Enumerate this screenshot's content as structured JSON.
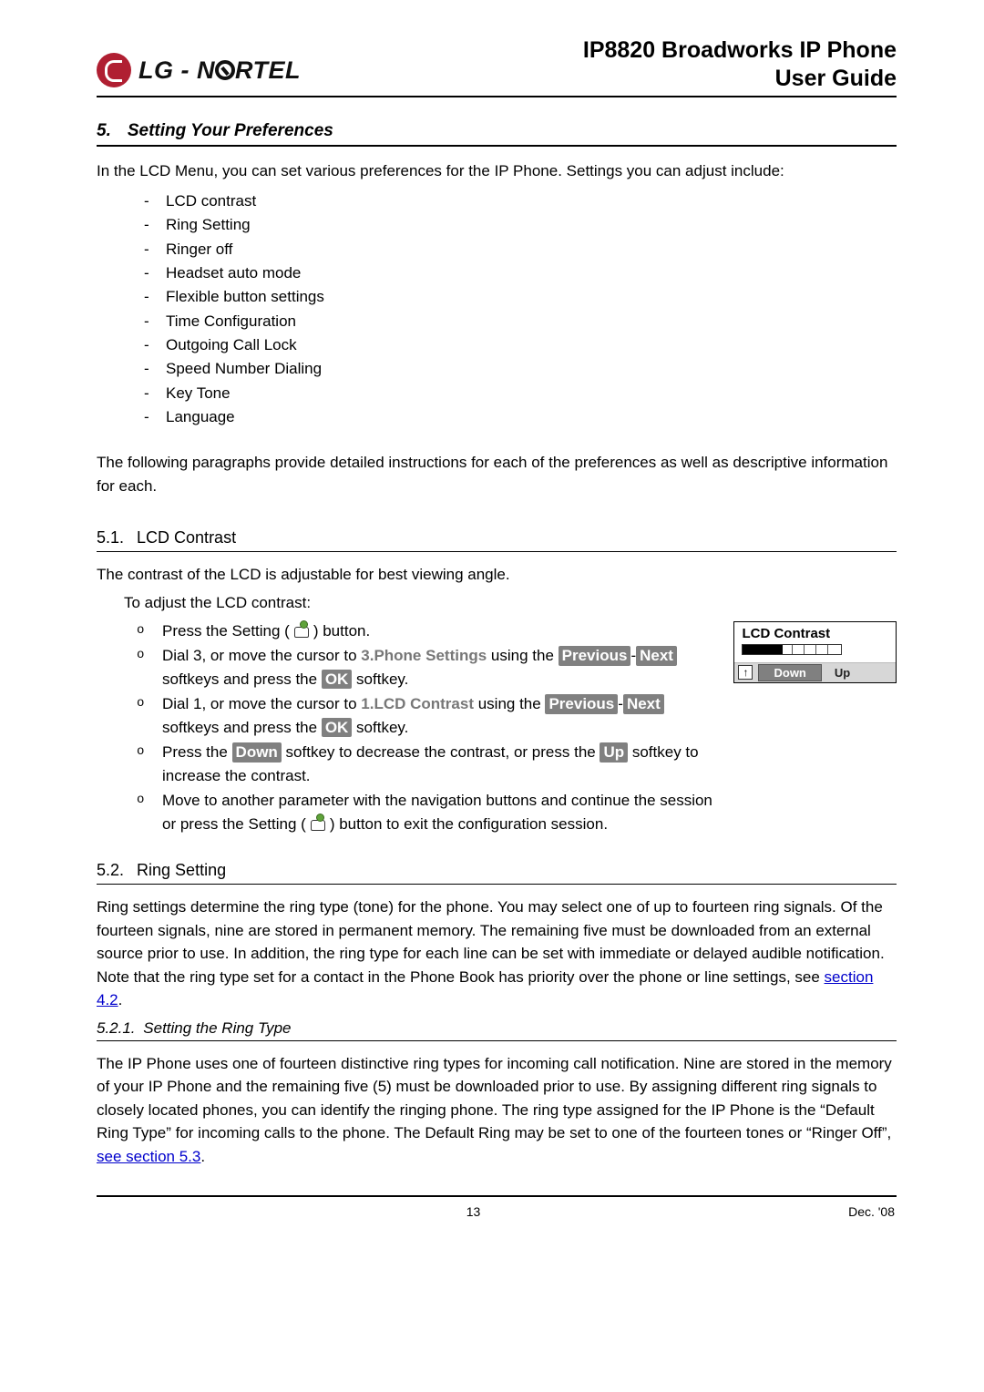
{
  "header": {
    "logo_text": "LG-N   RTEL",
    "title_l1": "IP8820 Broadworks IP Phone",
    "title_l2": "User Guide"
  },
  "section5": {
    "num": "5.",
    "title": "Setting Your Preferences",
    "intro": "In the LCD Menu, you can set various preferences for the IP Phone.  Settings you can adjust include:",
    "items": [
      "LCD contrast",
      "Ring Setting",
      "Ringer off",
      "Headset auto mode",
      "Flexible button settings",
      "Time Configuration",
      "Outgoing Call Lock",
      "Speed Number Dialing",
      "Key Tone",
      "Language"
    ],
    "outro": "The following paragraphs provide detailed instructions for each of the preferences as well as descriptive information for each."
  },
  "section51": {
    "num": "5.1.",
    "title": "LCD Contrast",
    "intro": "The contrast of the LCD is adjustable for best viewing angle.",
    "lead": "To adjust the LCD contrast:",
    "step1_a": "Press the Setting (",
    "step1_b": ") button.",
    "step2_a": "Dial 3, or move the cursor to ",
    "step2_menu": "3.Phone Settings",
    "step2_b": " using the ",
    "step2_c": " softkeys and press the ",
    "step2_d": " softkey.",
    "step3_a": "Dial 1, or move the cursor to ",
    "step3_menu": "1.LCD Contrast",
    "step3_b": " using the ",
    "step3_c": " softkeys and press the ",
    "step3_d": " softkey.",
    "step4_a": "Press the ",
    "step4_b": " softkey to decrease the contrast, or press the ",
    "step4_c": " softkey to increase the contrast.",
    "step5_a": "Move to another parameter with the navigation buttons and continue the session or press the Setting (",
    "step5_b": ") button to exit the configuration session.",
    "soft_previous": "Previous",
    "soft_next": "Next",
    "soft_ok": "OK",
    "soft_down": "Down",
    "soft_up": "Up",
    "lcd": {
      "title": "LCD Contrast",
      "down": "Down",
      "up": "Up",
      "arrow": "↑"
    }
  },
  "section52": {
    "num": "5.2.",
    "title": "Ring Setting",
    "para_a": "Ring settings determine the ring type (tone) for the phone.  You may select one of up to fourteen ring signals.  Of the fourteen signals, nine are stored in permanent memory.  The remaining five must be downloaded from an external source prior to use.  In addition, the ring type for each line can be set with immediate or delayed audible notification.  Note that the ring type set for a contact in the Phone Book has priority over the phone or line settings, see ",
    "link1": "section 4.2",
    "para_b": "."
  },
  "section521": {
    "num": "5.2.1.",
    "title": "Setting the Ring Type",
    "para_a": "The IP Phone uses one of fourteen distinctive ring types for incoming call notification.  Nine are stored in the memory of your IP Phone and the remaining five (5) must be downloaded prior to use.  By assigning different ring signals to closely located phones, you can identify the ringing phone.  The ring type assigned for the IP Phone is the “Default Ring Type” for incoming calls to the phone.  The Default Ring may be set to one of the fourteen tones or “Ringer Off”, ",
    "link1": "see section 5.3",
    "para_b": "."
  },
  "footer": {
    "page": "13",
    "date": "Dec. '08"
  }
}
